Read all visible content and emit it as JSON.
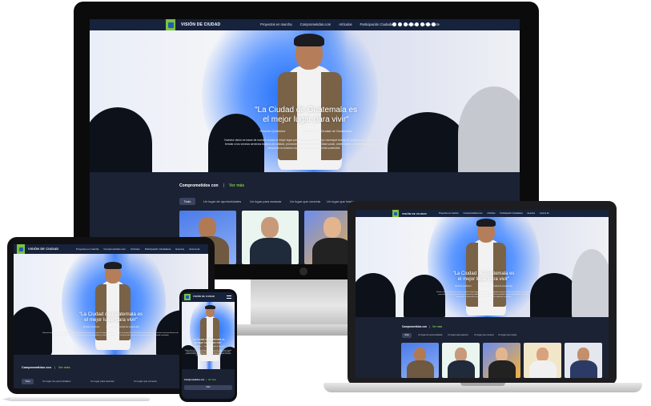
{
  "site": {
    "brand": "VISIÓN DE CIUDAD",
    "nav": [
      "Proyectos en marcha",
      "Comprometidos.com",
      "Artículos",
      "Participación Ciudadana",
      "Eventos",
      "Acerca de"
    ],
    "quote_line1": "\"La Ciudad de Guatemala es",
    "quote_line2": "el mejor lugar para vivir\"",
    "byline_name": "Ricardo Quiñónez",
    "byline_role": "Alcalde de la Ciudad de Guatemala",
    "paragraph": "Nuestra visión es hacer de nuestra ciudad el mejor lugar para vivir, y para el equipo municipal trabaja en proyectos innovadores para brindar a los vecinos servicios básicos de calidad, promoviendo también la movilidad social, ambientales y culturales, impulsando el desarrollo económico local y la gestión ambiental sostenible.",
    "section_title": "Comprometidos con",
    "see_all": "Ver más",
    "filters": [
      "Todo",
      "Un lugar de oportunidades",
      "Un lugar para avanzar",
      "Un lugar que conecta",
      "Un lugar que inspira"
    ],
    "colors": {
      "navy": "#17223c",
      "section_bg": "#1a2234",
      "accent_green": "#7bc142",
      "logo_blue": "#1f5fae"
    },
    "icons": [
      "facebook-icon",
      "instagram-icon",
      "twitter-icon",
      "youtube-icon",
      "tiktok-icon",
      "spotify-icon",
      "linkedin-icon",
      "whatsapp-icon"
    ]
  }
}
